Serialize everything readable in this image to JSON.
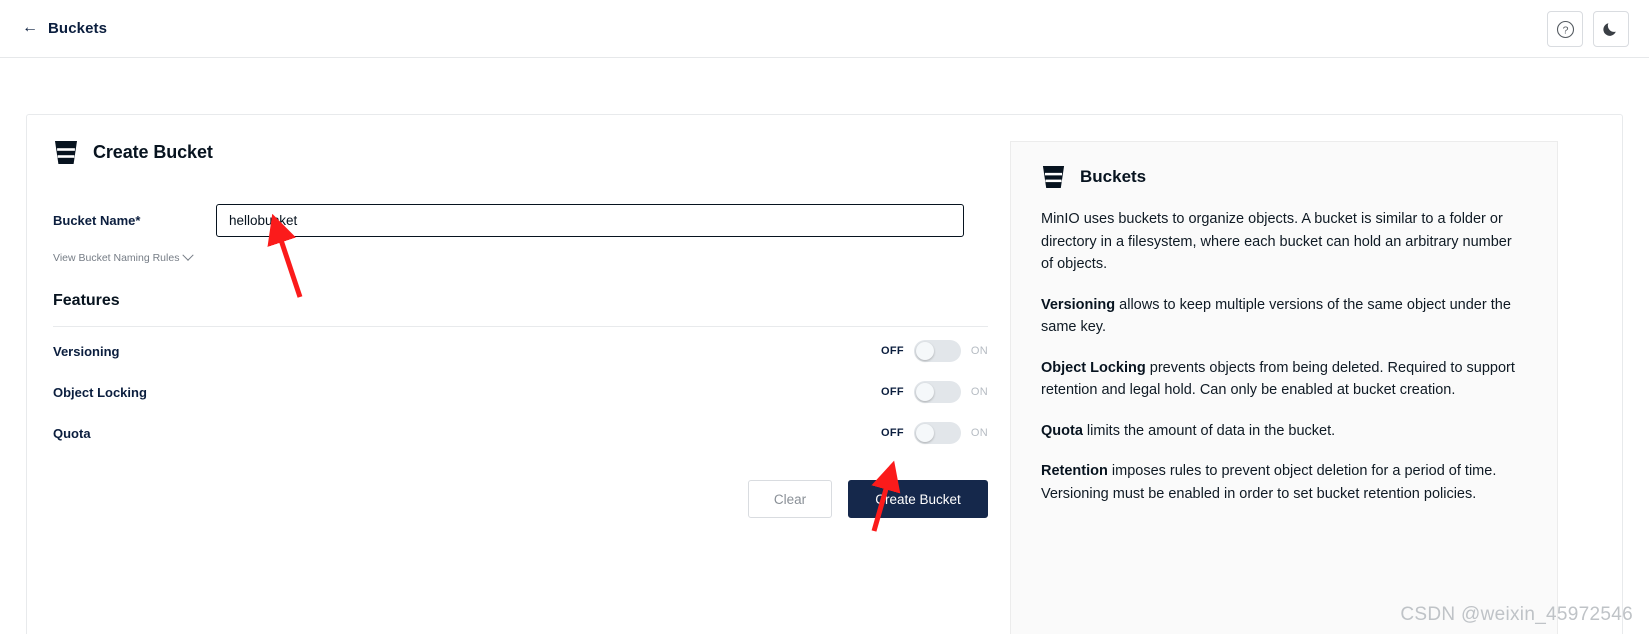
{
  "topbar": {
    "back_arrow": "←",
    "back_label": "Buckets",
    "help_icon": "question-mark-circle-icon",
    "theme_icon": "moon-icon"
  },
  "form": {
    "icon": "bucket-icon",
    "title": "Create Bucket",
    "bucket_name": {
      "label": "Bucket Name*",
      "value": "hellobucket",
      "placeholder": ""
    },
    "naming_rules_link": "View Bucket Naming Rules",
    "naming_rules_chevron": "chevron-down-icon",
    "features_title": "Features",
    "features": [
      {
        "name": "Versioning",
        "off_label": "OFF",
        "on_label": "ON",
        "state": "off"
      },
      {
        "name": "Object Locking",
        "off_label": "OFF",
        "on_label": "ON",
        "state": "off"
      },
      {
        "name": "Quota",
        "off_label": "OFF",
        "on_label": "ON",
        "state": "off"
      }
    ],
    "buttons": {
      "clear": "Clear",
      "create": "Create Bucket"
    }
  },
  "info": {
    "icon": "bucket-icon",
    "title": "Buckets",
    "paragraphs": [
      {
        "lead": "",
        "text": "MinIO uses buckets to organize objects. A bucket is similar to a folder or directory in a filesystem, where each bucket can hold an arbitrary number of objects."
      },
      {
        "lead": "Versioning",
        "text": " allows to keep multiple versions of the same object under the same key."
      },
      {
        "lead": "Object Locking",
        "text": " prevents objects from being deleted. Required to support retention and legal hold. Can only be enabled at bucket creation."
      },
      {
        "lead": "Quota",
        "text": " limits the amount of data in the bucket."
      },
      {
        "lead": "Retention",
        "text": " imposes rules to prevent object deletion for a period of time. Versioning must be enabled in order to set bucket retention policies."
      }
    ]
  },
  "watermark": "CSDN @weixin_45972546",
  "colors": {
    "accent_navy": "#15284b",
    "text_navy": "#0b1e3e",
    "panel_bg": "#fafafa",
    "annotation_red": "#fb1b1b"
  }
}
